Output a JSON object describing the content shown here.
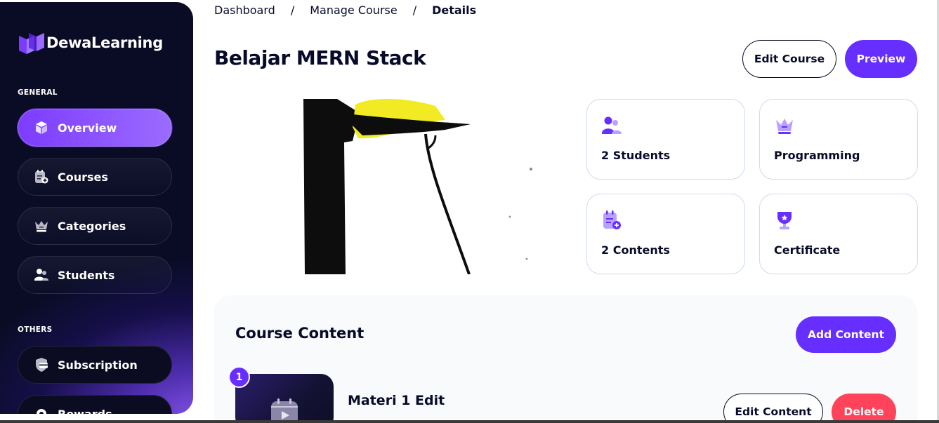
{
  "app": {
    "brand": "DewaLearning",
    "accent": "#662FFF",
    "danger": "#FF435A"
  },
  "sidebar": {
    "general_label": "GENERAL",
    "others_label": "OTHERS",
    "items": [
      {
        "label": "Overview",
        "icon": "cube-icon",
        "active": true
      },
      {
        "label": "Courses",
        "icon": "note-add-icon",
        "active": false
      },
      {
        "label": "Categories",
        "icon": "crown-icon",
        "active": false
      },
      {
        "label": "Students",
        "icon": "users-icon",
        "active": false
      }
    ],
    "others": [
      {
        "label": "Subscription",
        "icon": "security-card-icon"
      },
      {
        "label": "Rewards",
        "icon": "medal-icon"
      }
    ]
  },
  "breadcrumb": {
    "items": [
      "Dashboard",
      "Manage Course",
      "Details"
    ],
    "separator": "/"
  },
  "header": {
    "title": "Belajar MERN Stack",
    "edit_label": "Edit Course",
    "preview_label": "Preview"
  },
  "stats": [
    {
      "label": "2 Students",
      "icon": "users-icon"
    },
    {
      "label": "Programming",
      "icon": "crown-icon"
    },
    {
      "label": "2 Contents",
      "icon": "note-add-icon"
    },
    {
      "label": "Certificate",
      "icon": "cup-icon"
    }
  ],
  "course_content": {
    "title": "Course Content",
    "add_label": "Add Content",
    "lessons": [
      {
        "number": "1",
        "title": "Materi 1 Edit",
        "edit_label": "Edit Content",
        "delete_label": "Delete",
        "icon": "video-icon"
      }
    ]
  }
}
